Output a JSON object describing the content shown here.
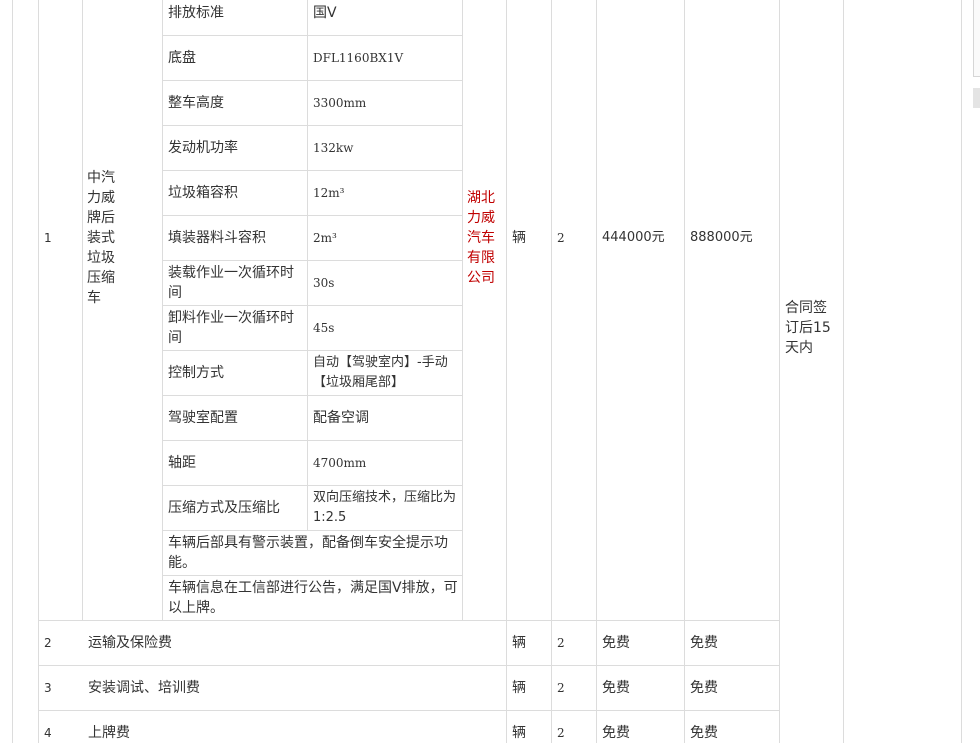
{
  "row1": {
    "index": "1",
    "name": "中汽力威牌后装式垃圾压缩车",
    "supplier": "湖北力威汽车有限公司",
    "unit": "辆",
    "qty": "2",
    "unit_price": "444000元",
    "total": "888000元",
    "specs": [
      {
        "label": "排放标准",
        "value": "国V"
      },
      {
        "label": "底盘",
        "value": "DFL1160BX1V"
      },
      {
        "label": "整车高度",
        "value": "3300mm"
      },
      {
        "label": "发动机功率",
        "value": "132kw"
      },
      {
        "label": "垃圾箱容积",
        "value": "12m³"
      },
      {
        "label": "填装器料斗容积",
        "value": "2m³"
      },
      {
        "label": "装载作业一次循环时间",
        "value": "30s"
      },
      {
        "label": "卸料作业一次循环时间",
        "value": "45s"
      },
      {
        "label": "控制方式",
        "value": "自动【驾驶室内】-手动【垃圾厢尾部】"
      },
      {
        "label": "驾驶室配置",
        "value": "配备空调"
      },
      {
        "label": "轴距",
        "value": "4700mm"
      },
      {
        "label": "压缩方式及压缩比",
        "value": "双向压缩技术，压缩比为1:2.5"
      }
    ],
    "notes": [
      "车辆后部具有警示装置，配备倒车安全提示功能。",
      "车辆信息在工信部进行公告，满足国V排放，可以上牌。"
    ]
  },
  "delivery": "合同签订后15天内",
  "rows": [
    {
      "index": "2",
      "name": "运输及保险费",
      "unit": "辆",
      "qty": "2",
      "unit_price": "免费",
      "total": "免费"
    },
    {
      "index": "3",
      "name": "安装调试、培训费",
      "unit": "辆",
      "qty": "2",
      "unit_price": "免费",
      "total": "免费"
    },
    {
      "index": "4",
      "name": "上牌费",
      "unit": "辆",
      "qty": "2",
      "unit_price": "免费",
      "total": "免费"
    }
  ]
}
